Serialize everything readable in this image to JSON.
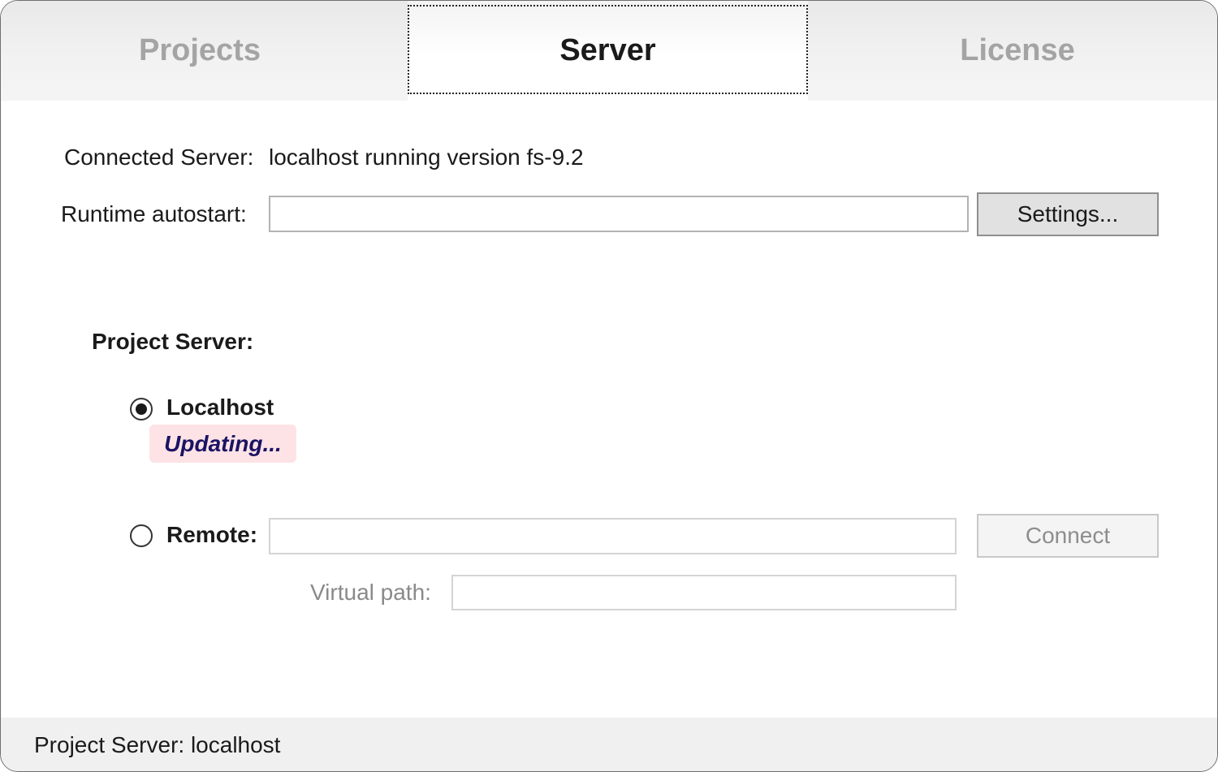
{
  "tabs": [
    {
      "label": "Projects",
      "active": false
    },
    {
      "label": "Server",
      "active": true
    },
    {
      "label": "License",
      "active": false
    }
  ],
  "server": {
    "connected_label": "Connected Server:",
    "connected_value": "localhost running version fs-9.2",
    "autostart_label": "Runtime autostart:",
    "autostart_value": "",
    "settings_button": "Settings..."
  },
  "project_server": {
    "heading": "Project Server:",
    "localhost_label": "Localhost",
    "localhost_selected": true,
    "status": "Updating...",
    "remote_label": "Remote:",
    "remote_selected": false,
    "remote_value": "",
    "connect_button": "Connect",
    "virtual_path_label": "Virtual path:",
    "virtual_path_value": ""
  },
  "statusbar": {
    "text": "Project Server: localhost"
  },
  "colors": {
    "status_bg": "#fde3e6",
    "status_text": "#1b1464",
    "inactive_tab": "#a4a4a4"
  }
}
